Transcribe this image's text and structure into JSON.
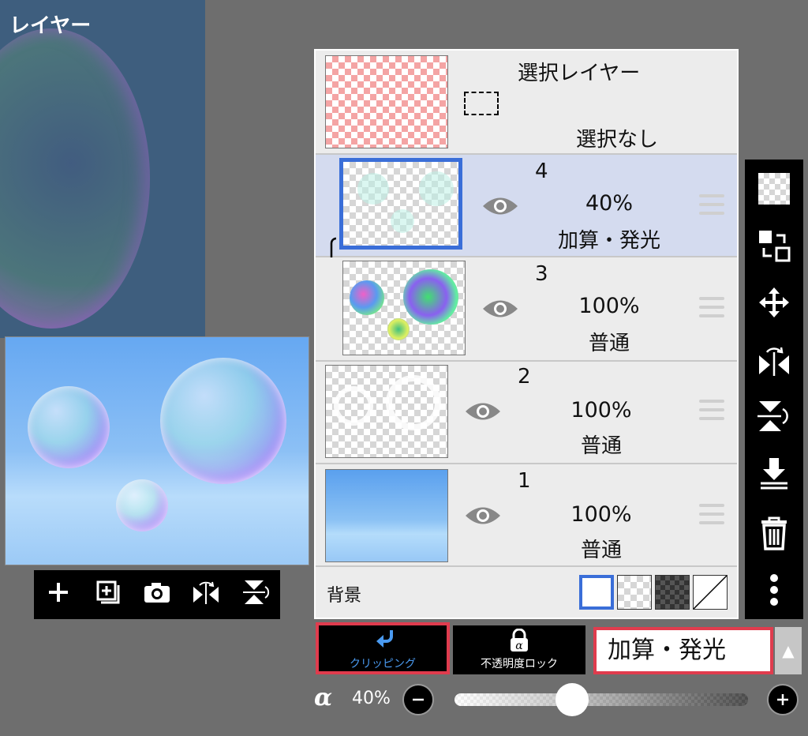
{
  "canvas": {
    "title": "レイヤー"
  },
  "preview_toolbar": {
    "items": [
      {
        "icon": "plus-icon"
      },
      {
        "icon": "add-layer-icon"
      },
      {
        "icon": "camera-icon"
      },
      {
        "icon": "flip-horizontal-icon"
      },
      {
        "icon": "flip-vertical-icon"
      }
    ]
  },
  "selection_layer": {
    "title": "選択レイヤー",
    "status": "選択なし"
  },
  "layers": [
    {
      "number": "4",
      "opacity": "40%",
      "blend": "加算・発光",
      "selected": true,
      "clipped": true
    },
    {
      "number": "3",
      "opacity": "100%",
      "blend": "普通",
      "selected": false,
      "clipped": false
    },
    {
      "number": "2",
      "opacity": "100%",
      "blend": "普通",
      "selected": false,
      "clipped": false
    },
    {
      "number": "1",
      "opacity": "100%",
      "blend": "普通",
      "selected": false,
      "clipped": false
    }
  ],
  "background": {
    "label": "背景",
    "options": [
      "white",
      "transparent",
      "dark-checker",
      "none"
    ],
    "selected": "white"
  },
  "right_toolbar": {
    "items": [
      {
        "icon": "checkerboard-icon"
      },
      {
        "icon": "swap-layer-icon"
      },
      {
        "icon": "move-icon"
      },
      {
        "icon": "flip-horizontal-icon"
      },
      {
        "icon": "flip-vertical-icon"
      },
      {
        "icon": "merge-down-icon"
      },
      {
        "icon": "trash-icon"
      },
      {
        "icon": "more-vertical-icon"
      }
    ]
  },
  "controls": {
    "clipping_label": "クリッピング",
    "opacity_lock_label": "不透明度ロック",
    "blend_mode": "加算・発光",
    "alpha_symbol": "α",
    "alpha_value": "40%",
    "alpha_fraction": 0.4
  },
  "colors": {
    "accent_red": "#e03c4e",
    "selected_blue": "#3a6ed8",
    "clip_blue": "#4a9af0"
  }
}
